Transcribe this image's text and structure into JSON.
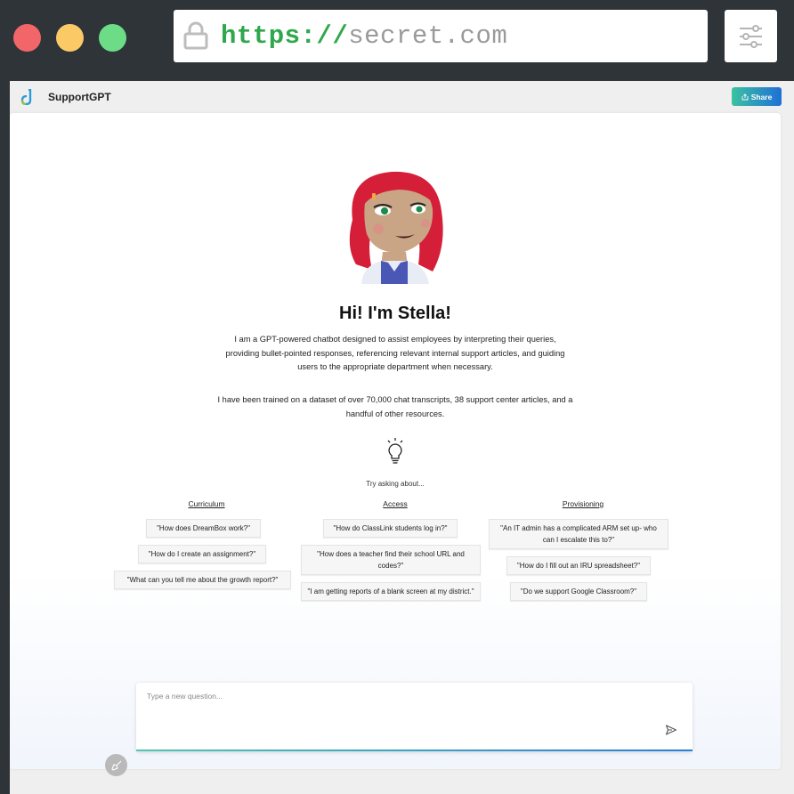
{
  "browser": {
    "url_scheme": "https://",
    "url_host": "secret.com"
  },
  "app": {
    "title": "SupportGPT",
    "share_label": "Share"
  },
  "intro": {
    "greeting": "Hi! I'm Stella!",
    "description": "I am a GPT-powered chatbot designed to assist employees by interpreting their queries, providing bullet-pointed responses, referencing relevant internal support articles, and guiding users to the appropriate department when necessary.",
    "training": "I have been trained on a dataset of over 70,000 chat transcripts, 38 support center articles, and a handful of other resources.",
    "try_label": "Try asking about..."
  },
  "suggestions": [
    {
      "heading": "Curriculum",
      "items": [
        "\"How does DreamBox work?\"",
        "\"How do I create an assignment?\"",
        "\"What can you tell me about the growth report?\""
      ]
    },
    {
      "heading": "Access",
      "items": [
        "\"How do ClassLink students log in?\"",
        "\"How does a teacher find their school URL and codes?\"",
        "\"I am getting reports of a blank screen at my district.\""
      ]
    },
    {
      "heading": "Provisioning",
      "items": [
        "\"An IT admin has a complicated ARM set up- who can I escalate this to?\"",
        "\"How do I fill out an IRU spreadsheet?\"",
        "\"Do we support Google Classroom?\""
      ]
    }
  ],
  "composer": {
    "placeholder": "Type a new question...",
    "value": ""
  },
  "colors": {
    "chrome_bg": "#2e3438",
    "url_scheme": "#2ea84a",
    "accent_start": "#3cc2a0",
    "accent_end": "#1f6fd6"
  },
  "icons": {
    "lock": "lock-icon",
    "settings": "sliders-icon",
    "logo": "app-logo-icon",
    "share": "share-icon",
    "bulb": "lightbulb-icon",
    "send": "send-icon",
    "clear": "broom-icon"
  }
}
